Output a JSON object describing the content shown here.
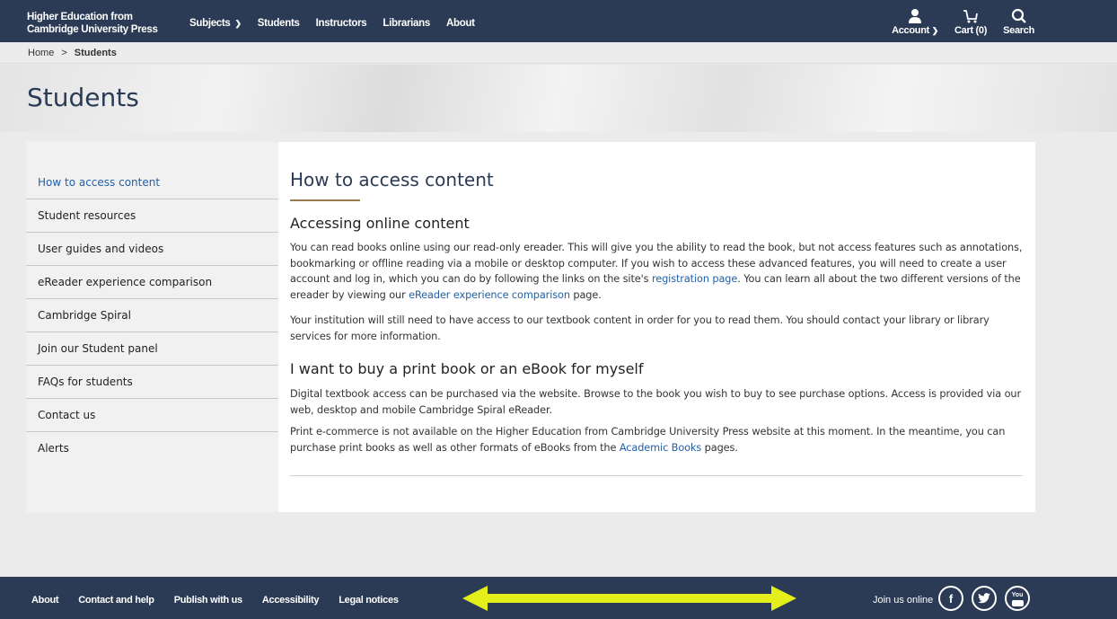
{
  "header": {
    "brand_line1": "Higher Education from",
    "brand_line2": "Cambridge University Press",
    "nav": [
      "Subjects",
      "Students",
      "Instructors",
      "Librarians",
      "About"
    ],
    "account_label": "Account",
    "cart_label": "Cart (0)",
    "search_label": "Search"
  },
  "breadcrumb": {
    "home": "Home",
    "sep": ">",
    "current": "Students"
  },
  "hero": {
    "title": "Students"
  },
  "sidebar": {
    "items": [
      "How to access content",
      "Student resources",
      "User guides and videos",
      "eReader experience comparison",
      "Cambridge Spiral",
      "Join our Student panel",
      "FAQs for students",
      "Contact us",
      "Alerts"
    ]
  },
  "content": {
    "title": "How to access content",
    "section1_heading": "Accessing online content",
    "p1_a": "You can read books online using our read-only ereader. This will give you the ability to read the book, but not access features such as annotations, bookmarking or offline reading via a mobile or desktop computer. If you wish to access these advanced features, you will need to create a user account and log in, which you can do by following the links on the site's ",
    "p1_link1": "registration page",
    "p1_b": ". You can learn all about the two different versions of the ereader by viewing our ",
    "p1_link2": "eReader experience comparison",
    "p1_c": " page.",
    "p2": "Your institution will still need to have access to our textbook content in order for you to read them. You should contact your library or library services for more information.",
    "section2_heading": "I want to buy a print book or an eBook for myself",
    "p3": "Digital textbook access can be purchased via the website. Browse to the book you wish to buy to see purchase options. Access is provided via our web, desktop and mobile Cambridge Spiral eReader.",
    "p4_a": "Print e-commerce is not available on the Higher Education from Cambridge University Press website at this moment. In the meantime, you can purchase print books as well as other formats of eBooks from the ",
    "p4_link": "Academic Books",
    "p4_b": " pages."
  },
  "footer": {
    "links": [
      "About",
      "Contact and help",
      "Publish with us",
      "Accessibility",
      "Legal notices"
    ],
    "join_label": "Join us online",
    "social": [
      "facebook-icon",
      "twitter-icon",
      "youtube-icon"
    ],
    "youtube_text": "You"
  },
  "colors": {
    "navy": "#2b3b55",
    "link": "#2360a8",
    "accent": "#9a7b4f",
    "arrow": "#e3ee1a"
  }
}
